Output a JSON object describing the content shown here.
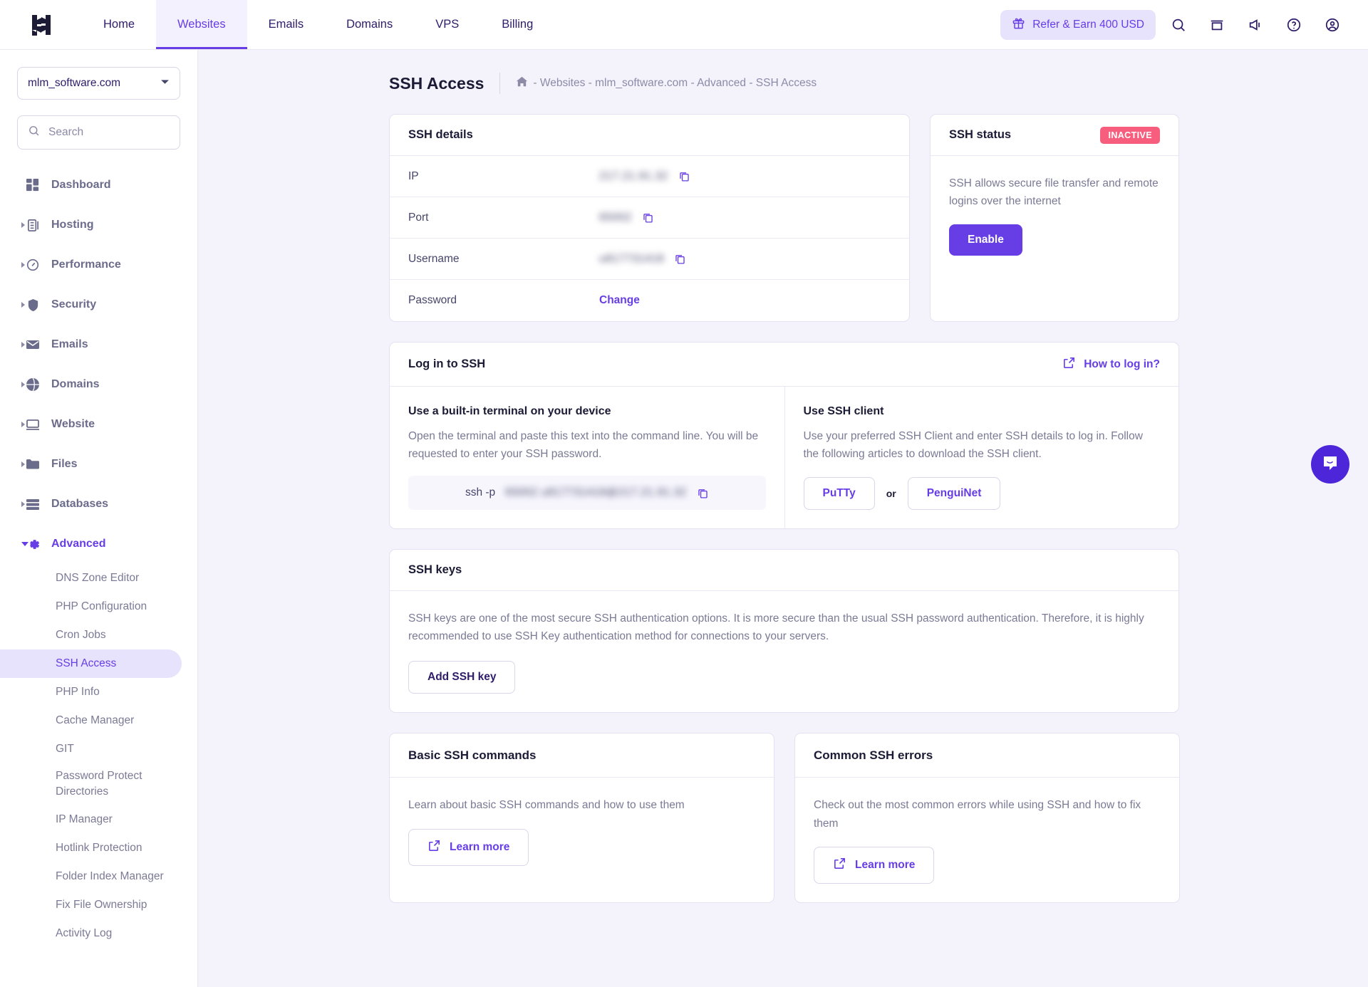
{
  "topbar": {
    "logo_name": "hostinger-logo",
    "nav": [
      {
        "label": "Home",
        "active": false
      },
      {
        "label": "Websites",
        "active": true
      },
      {
        "label": "Emails",
        "active": false
      },
      {
        "label": "Domains",
        "active": false
      },
      {
        "label": "VPS",
        "active": false
      },
      {
        "label": "Billing",
        "active": false
      }
    ],
    "refer_label": "Refer & Earn 400 USD",
    "icons": [
      "search-icon",
      "store-icon",
      "megaphone-icon",
      "help-circle-icon",
      "account-circle-icon"
    ]
  },
  "sidebar": {
    "domain_selected": "mlm_software.com",
    "search_placeholder": "Search",
    "search_value": "",
    "items": [
      {
        "label": "Dashboard",
        "icon": "dashboard-icon",
        "expandable": false
      },
      {
        "label": "Hosting",
        "icon": "server-icon",
        "expandable": true
      },
      {
        "label": "Performance",
        "icon": "gauge-icon",
        "expandable": true
      },
      {
        "label": "Security",
        "icon": "shield-icon",
        "expandable": true
      },
      {
        "label": "Emails",
        "icon": "envelope-icon",
        "expandable": true
      },
      {
        "label": "Domains",
        "icon": "globe-icon",
        "expandable": true
      },
      {
        "label": "Website",
        "icon": "monitor-icon",
        "expandable": true
      },
      {
        "label": "Files",
        "icon": "folder-icon",
        "expandable": true
      },
      {
        "label": "Databases",
        "icon": "database-icon",
        "expandable": true
      },
      {
        "label": "Advanced",
        "icon": "gear-icon",
        "expandable": true,
        "expanded": true
      }
    ],
    "advanced_sub": [
      {
        "label": "DNS Zone Editor",
        "active": false
      },
      {
        "label": "PHP Configuration",
        "active": false
      },
      {
        "label": "Cron Jobs",
        "active": false
      },
      {
        "label": "SSH Access",
        "active": true
      },
      {
        "label": "PHP Info",
        "active": false
      },
      {
        "label": "Cache Manager",
        "active": false
      },
      {
        "label": "GIT",
        "active": false
      },
      {
        "label": "Password Protect Directories",
        "active": false,
        "multiline": true
      },
      {
        "label": "IP Manager",
        "active": false
      },
      {
        "label": "Hotlink Protection",
        "active": false
      },
      {
        "label": "Folder Index Manager",
        "active": false
      },
      {
        "label": "Fix File Ownership",
        "active": false
      },
      {
        "label": "Activity Log",
        "active": false
      }
    ]
  },
  "page": {
    "title": "SSH Access",
    "breadcrumb": "- Websites - mlm_software.com - Advanced - SSH Access",
    "home_icon": "home-icon"
  },
  "ssh_details": {
    "title": "SSH details",
    "rows": [
      {
        "label": "IP",
        "value": "217.21.91.32",
        "redacted": true,
        "copy": true
      },
      {
        "label": "Port",
        "value": "65002",
        "redacted": true,
        "copy": true
      },
      {
        "label": "Username",
        "value": "u817731418",
        "redacted": true,
        "copy": true
      }
    ],
    "password_label": "Password",
    "password_action": "Change"
  },
  "ssh_status": {
    "title": "SSH status",
    "badge": "INACTIVE",
    "description": "SSH allows secure file transfer and remote logins over the internet",
    "enable_label": "Enable"
  },
  "login_card": {
    "title": "Log in to SSH",
    "howto_label": "How to log in?",
    "terminal": {
      "heading": "Use a built-in terminal on your device",
      "description": "Open the terminal and paste this text into the command line. You will be requested to enter your SSH password.",
      "command_prefix": "ssh -p",
      "command_redacted": "65002 u817731418@217.21.91.32"
    },
    "client": {
      "heading": "Use SSH client",
      "description": "Use your preferred SSH Client and enter SSH details to log in. Follow the following articles to download the SSH client.",
      "putty_label": "PuTTy",
      "or_label": "or",
      "penguinet_label": "PenguiNet"
    }
  },
  "ssh_keys": {
    "title": "SSH keys",
    "description": "SSH keys are one of the most secure SSH authentication options. It is more secure than the usual SSH password authentication. Therefore, it is highly recommended to use SSH Key authentication method for connections to your servers.",
    "add_label": "Add SSH key"
  },
  "info_cards": [
    {
      "title": "Basic SSH commands",
      "description": "Learn about basic SSH commands and how to use them",
      "button_label": "Learn more"
    },
    {
      "title": "Common SSH errors",
      "description": "Check out the most common errors while using SSH and how to fix them",
      "button_label": "Learn more"
    }
  ],
  "chat": {
    "icon": "chat-bubble-icon"
  },
  "colors": {
    "accent": "#673de6",
    "accent_soft": "#e8e3fc",
    "danger": "#f75e7e",
    "page_bg": "#f4f3fc",
    "text": "#1b1b36",
    "muted": "#7b7a95"
  }
}
